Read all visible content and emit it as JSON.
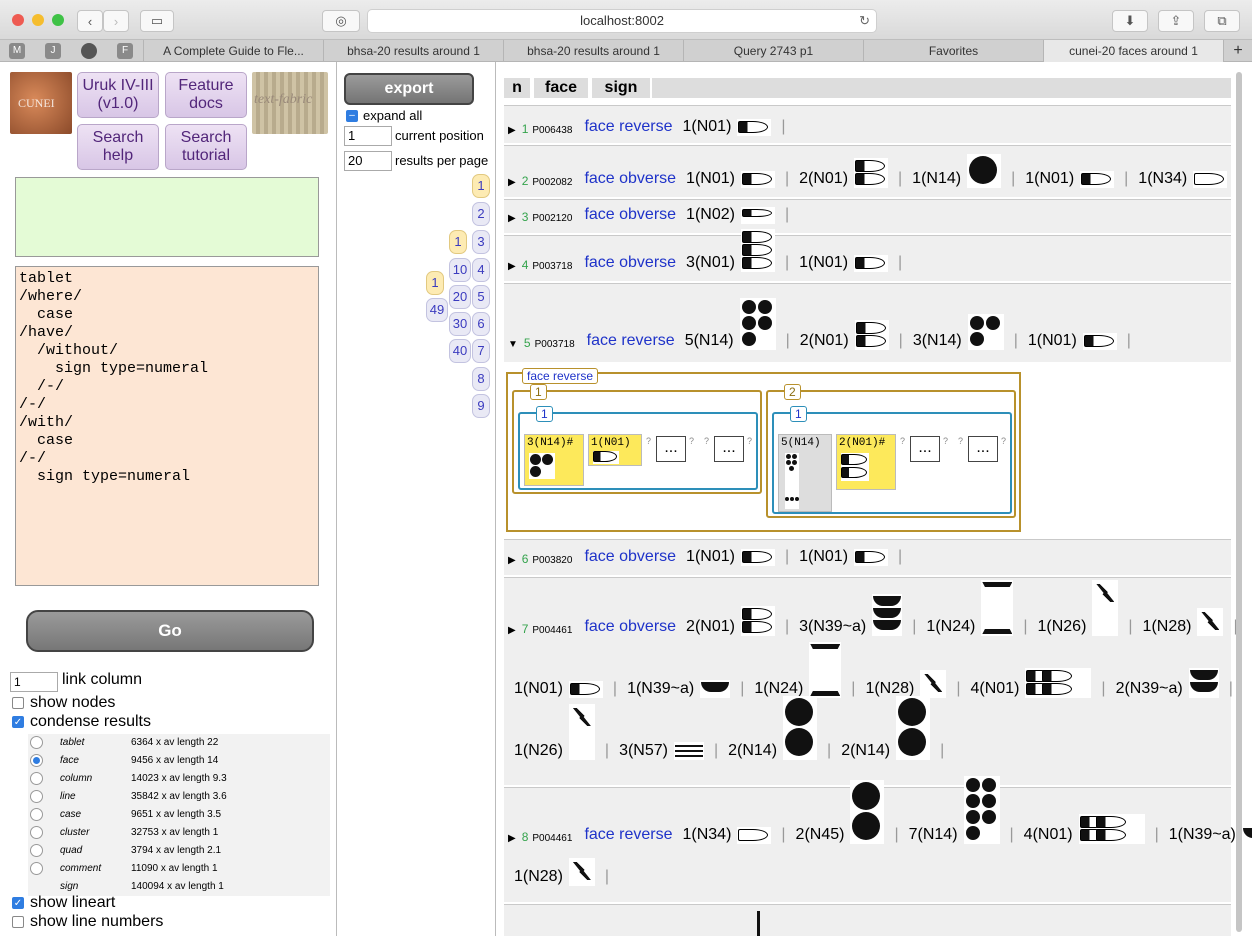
{
  "browser": {
    "url": "localhost:8002",
    "tabs": [
      "A Complete Guide to Fle...",
      "bhsa-20 results around 1",
      "bhsa-20 results around 1",
      "Query 2743 p1",
      "Favorites",
      "cunei-20 faces around 1"
    ],
    "bookmarks": [
      "M",
      "J",
      "",
      "F"
    ],
    "new_tab": "+"
  },
  "left": {
    "nav": {
      "corpus": "Uruk IV-III (v1.0)",
      "feature_docs": "Feature docs",
      "search_help": "Search help",
      "search_tutorial": "Search tutorial"
    },
    "logo_left_text": "CUNEI",
    "logo_right_text": "text-fabric",
    "query": "tablet\n/where/\n  case\n/have/\n  /without/\n    sign type=numeral\n  /-/\n/-/\n/with/\n  case\n/-/\n  sign type=numeral",
    "go_label": "Go",
    "link_column_value": "1",
    "link_column_label": "link column",
    "show_nodes": "show nodes",
    "condense_results": "condense results",
    "condense_types": [
      {
        "name": "tablet",
        "info": "6364 x av length 22",
        "selected": false
      },
      {
        "name": "face",
        "info": "9456 x av length 14",
        "selected": true
      },
      {
        "name": "column",
        "info": "14023 x av length 9.3",
        "selected": false
      },
      {
        "name": "line",
        "info": "35842 x av length 3.6",
        "selected": false
      },
      {
        "name": "case",
        "info": "9651 x av length 3.5",
        "selected": false
      },
      {
        "name": "cluster",
        "info": "32753 x av length 1",
        "selected": false
      },
      {
        "name": "quad",
        "info": "3794 x av length 2.1",
        "selected": false
      },
      {
        "name": "comment",
        "info": "11090 x av length 1",
        "selected": false
      },
      {
        "name": "sign",
        "info": "140094 x av length 1",
        "selected": false
      }
    ],
    "show_lineart": "show lineart",
    "show_line_numbers": "show line numbers"
  },
  "mid": {
    "export": "export",
    "expand_all": "expand all",
    "current_position_value": "1",
    "current_position_label": "current position",
    "results_per_page_value": "20",
    "results_per_page_label": "results per page",
    "pages_col3": [
      "1",
      "2",
      "3",
      "4",
      "5",
      "6",
      "7",
      "8",
      "9"
    ],
    "pages_col2": [
      "1",
      "10",
      "20",
      "30",
      "40"
    ],
    "pages_col1": [
      "1",
      "49"
    ]
  },
  "results": {
    "headers": [
      "n",
      "face",
      "sign"
    ],
    "rows": [
      {
        "n": "1",
        "pid": "P006438",
        "face": "face reverse",
        "signs": [
          "1(N01)"
        ]
      },
      {
        "n": "2",
        "pid": "P002082",
        "face": "face obverse",
        "signs": [
          "1(N01)",
          "2(N01)",
          "1(N14)",
          "1(N01)",
          "1(N34)"
        ]
      },
      {
        "n": "3",
        "pid": "P002120",
        "face": "face obverse",
        "signs": [
          "1(N02)"
        ]
      },
      {
        "n": "4",
        "pid": "P003718",
        "face": "face obverse",
        "signs": [
          "3(N01)",
          "1(N01)"
        ]
      },
      {
        "n": "5",
        "pid": "P003718",
        "face": "face reverse",
        "signs": [
          "5(N14)",
          "2(N01)",
          "3(N14)",
          "1(N01)"
        ]
      },
      {
        "n": "6",
        "pid": "P003820",
        "face": "face obverse",
        "signs": [
          "1(N01)",
          "1(N01)"
        ]
      },
      {
        "n": "7",
        "pid": "P004461",
        "face": "face obverse",
        "signs": [
          "2(N01)",
          "3(N39~a)",
          "1(N24)",
          "1(N26)",
          "1(N28)",
          "1(N01)",
          "1(N39~a)",
          "1(N24)",
          "1(N28)",
          "4(N01)",
          "2(N39~a)",
          "1(N26)",
          "3(N57)",
          "2(N14)",
          "2(N14)"
        ]
      },
      {
        "n": "8",
        "pid": "P004461",
        "face": "face reverse",
        "signs": [
          "1(N34)",
          "2(N45)",
          "7(N14)",
          "4(N01)",
          "1(N39~a)",
          "1(N28)"
        ]
      }
    ],
    "expanded": {
      "label": "face reverse",
      "cols": [
        "1",
        "2"
      ],
      "lines": [
        "1",
        "1"
      ],
      "cells": [
        "3(N14)#",
        "1(N01)",
        "5(N14)",
        "2(N01)#"
      ],
      "ellipsis": "...",
      "q": "?"
    }
  }
}
